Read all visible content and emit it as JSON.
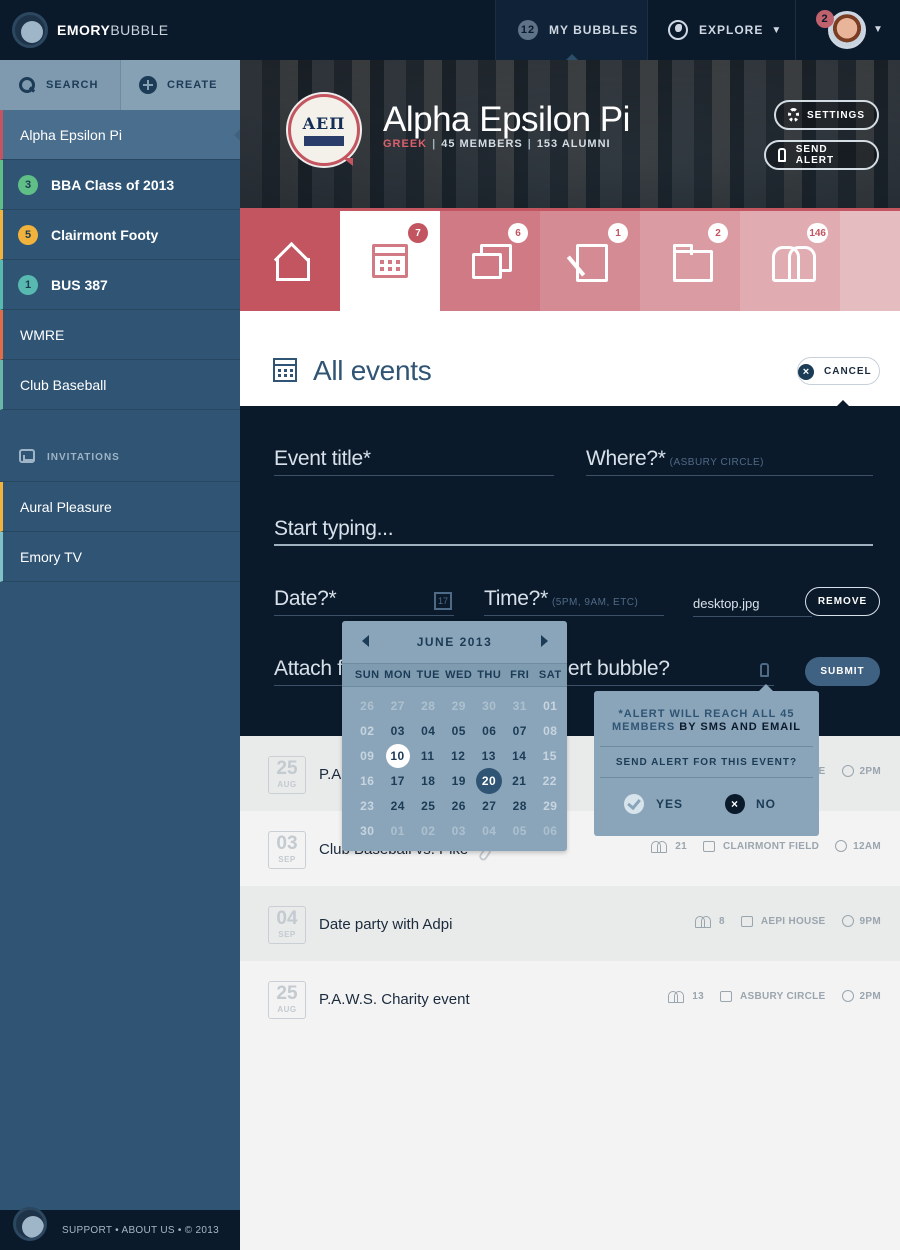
{
  "topbar": {
    "logo_bold": "EMORY",
    "logo_light": "BUBBLE",
    "bubbles_count": "12",
    "bubbles_label": "MY BUBBLES",
    "explore_label": "EXPLORE",
    "notifications": "2"
  },
  "sidebar": {
    "search_label": "SEARCH",
    "create_label": "CREATE",
    "items": [
      {
        "label": "Alpha Epsilon Pi",
        "badge": "",
        "color": "#c2555f"
      },
      {
        "label": "BBA Class of 2013",
        "badge": "3",
        "color": "#5fbf86"
      },
      {
        "label": "Clairmont Footy",
        "badge": "5",
        "color": "#f2b33d"
      },
      {
        "label": "BUS 387",
        "badge": "1",
        "color": "#58b9b0"
      },
      {
        "label": "WMRE",
        "badge": "",
        "color": "#e06d47"
      },
      {
        "label": "Club Baseball",
        "badge": "",
        "color": "#6ab7a8"
      }
    ],
    "invitations_label": "INVITATIONS",
    "invitations": [
      {
        "label": "Aural Pleasure",
        "color": "#f2b33d"
      },
      {
        "label": "Emory TV",
        "color": "#7fc3c9"
      }
    ],
    "footer_text": "SUPPORT • ABOUT US • © 2013"
  },
  "group": {
    "crest_letters": "ΑΕΠ",
    "name": "Alpha Epsilon Pi",
    "category": "GREEK",
    "members": "45 MEMBERS",
    "alumni": "153 ALUMNI",
    "settings_label": "SETTINGS",
    "send_alert_label": "SEND ALERT"
  },
  "tabs": [
    {
      "icon": "home-icon",
      "badge": "",
      "bg": "#c2555f"
    },
    {
      "icon": "calendar-icon",
      "badge": "7",
      "bg": "#ffffff"
    },
    {
      "icon": "chat-icon",
      "badge": "6",
      "bg": "#cf7a84"
    },
    {
      "icon": "document-icon",
      "badge": "1",
      "bg": "#d58b93"
    },
    {
      "icon": "folder-icon",
      "badge": "2",
      "bg": "#da9ba2"
    },
    {
      "icon": "people-icon",
      "badge": "146",
      "bg": "#e0acb1"
    }
  ],
  "page": {
    "title": "All events",
    "cancel_label": "CANCEL"
  },
  "form": {
    "event_title": "Event title*",
    "where_label": "Where?*",
    "where_hint": "(ASBURY CIRCLE)",
    "description_placeholder": "Start typing...",
    "date_label": "Date?*",
    "calendar_icon_number": "17",
    "time_label": "Time?*",
    "time_hint": "(5PM, 9AM, ETC)",
    "file_name": "desktop.jpg",
    "remove_label": "REMOVE",
    "attach_label": "Attach f",
    "alert_label": "ert bubble?",
    "submit_label": "SUBMIT"
  },
  "datepicker": {
    "month": "JUNE 2013",
    "days": [
      "SUN",
      "MON",
      "TUE",
      "WED",
      "THU",
      "FRI",
      "SAT"
    ],
    "weeks": [
      [
        {
          "d": "26",
          "s": "muted"
        },
        {
          "d": "27",
          "s": "muted"
        },
        {
          "d": "28",
          "s": "muted"
        },
        {
          "d": "29",
          "s": "muted"
        },
        {
          "d": "30",
          "s": "muted"
        },
        {
          "d": "31",
          "s": "muted"
        },
        {
          "d": "01",
          "s": "wk"
        }
      ],
      [
        {
          "d": "02",
          "s": "wk"
        },
        {
          "d": "03",
          "s": ""
        },
        {
          "d": "04",
          "s": ""
        },
        {
          "d": "05",
          "s": ""
        },
        {
          "d": "06",
          "s": ""
        },
        {
          "d": "07",
          "s": ""
        },
        {
          "d": "08",
          "s": "wk"
        }
      ],
      [
        {
          "d": "09",
          "s": "wk"
        },
        {
          "d": "10",
          "s": "today"
        },
        {
          "d": "11",
          "s": ""
        },
        {
          "d": "12",
          "s": ""
        },
        {
          "d": "13",
          "s": ""
        },
        {
          "d": "14",
          "s": ""
        },
        {
          "d": "15",
          "s": "wk"
        }
      ],
      [
        {
          "d": "16",
          "s": "wk"
        },
        {
          "d": "17",
          "s": ""
        },
        {
          "d": "18",
          "s": ""
        },
        {
          "d": "19",
          "s": ""
        },
        {
          "d": "20",
          "s": "sel"
        },
        {
          "d": "21",
          "s": ""
        },
        {
          "d": "22",
          "s": "wk"
        }
      ],
      [
        {
          "d": "23",
          "s": "wk"
        },
        {
          "d": "24",
          "s": ""
        },
        {
          "d": "25",
          "s": ""
        },
        {
          "d": "26",
          "s": ""
        },
        {
          "d": "27",
          "s": ""
        },
        {
          "d": "28",
          "s": ""
        },
        {
          "d": "29",
          "s": "wk"
        }
      ],
      [
        {
          "d": "30",
          "s": "wk"
        },
        {
          "d": "01",
          "s": "muted"
        },
        {
          "d": "02",
          "s": "muted"
        },
        {
          "d": "03",
          "s": "muted"
        },
        {
          "d": "04",
          "s": "muted"
        },
        {
          "d": "05",
          "s": "muted"
        },
        {
          "d": "06",
          "s": "muted"
        }
      ]
    ]
  },
  "alert_popover": {
    "message_start": "*ALERT WILL REACH ALL 45 MEMBERS",
    "message_end": "BY SMS AND EMAIL",
    "question": "SEND ALERT FOR THIS EVENT?",
    "yes_label": "YES",
    "no_label": "NO"
  },
  "events": [
    {
      "day": "25",
      "month": "AUG",
      "title": "P.A",
      "attendees": "",
      "location": "LE",
      "time": "2PM",
      "alt": true
    },
    {
      "day": "03",
      "month": "SEP",
      "title": "Club Baseball vs. Pike",
      "attendees": "21",
      "location": "CLAIRMONT FIELD",
      "time": "12AM",
      "alt": false
    },
    {
      "day": "04",
      "month": "SEP",
      "title": "Date party with Adpi",
      "attendees": "8",
      "location": "AEPI HOUSE",
      "time": "9PM",
      "alt": true
    },
    {
      "day": "25",
      "month": "AUG",
      "title": "P.A.W.S. Charity event",
      "attendees": "13",
      "location": "ASBURY CIRCLE",
      "time": "2PM",
      "alt": false
    }
  ]
}
